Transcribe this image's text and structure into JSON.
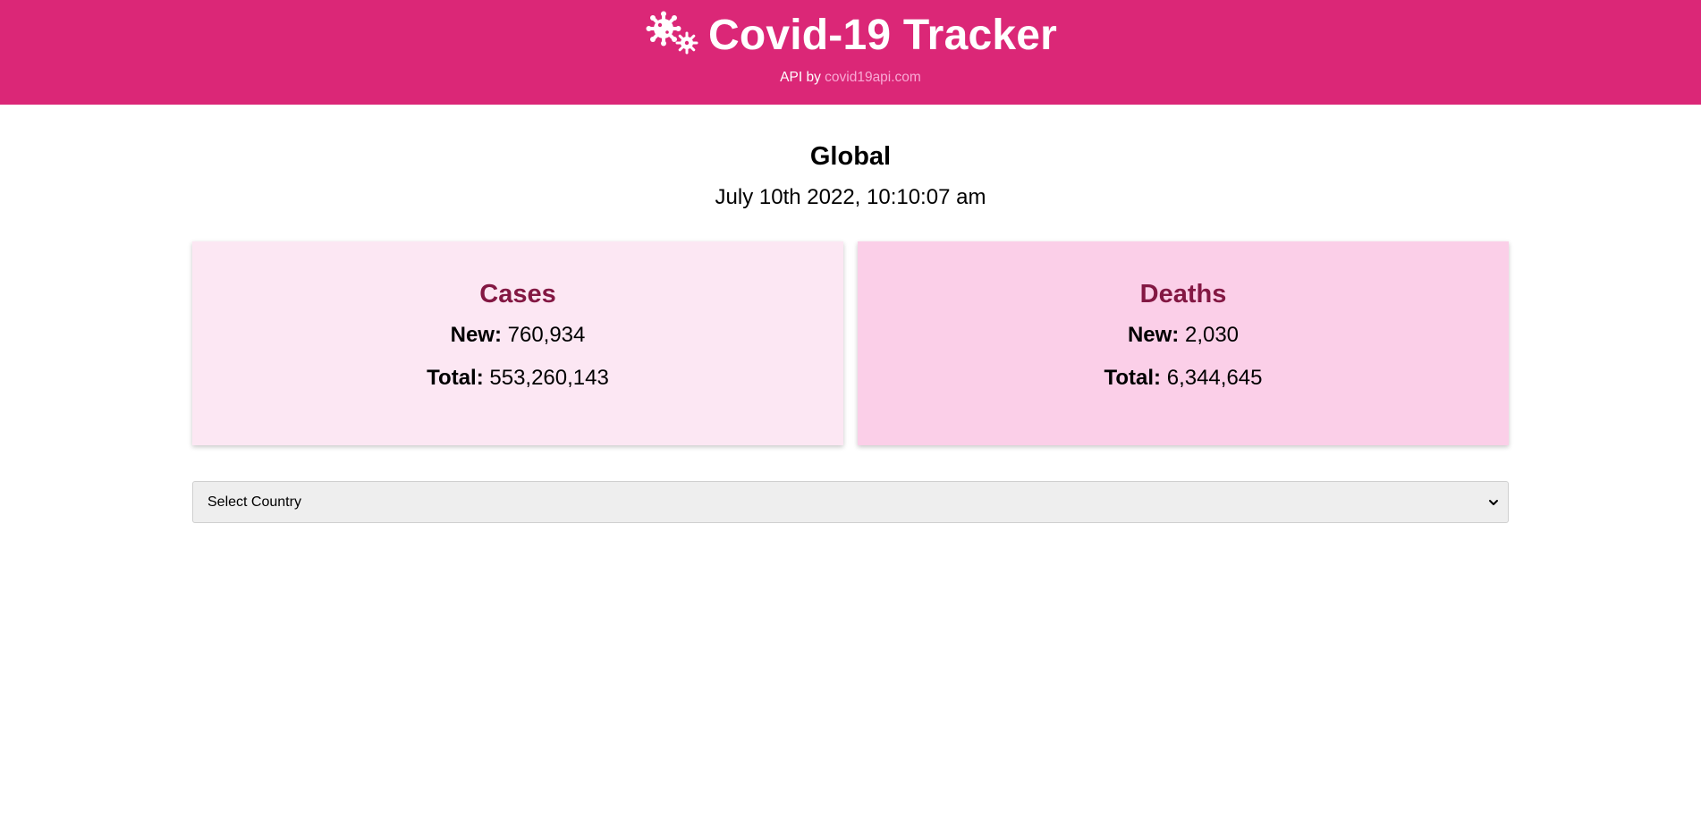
{
  "header": {
    "app_title": "Covid-19 Tracker",
    "api_prefix": "API by",
    "api_link_text": "covid19api.com",
    "logo_icon": "virus-gears-icon",
    "background_color": "#db2777",
    "link_color": "#f9a8d4"
  },
  "main": {
    "region_title": "Global",
    "timestamp": "July 10th 2022, 10:10:07 am",
    "cards": {
      "cases": {
        "title": "Cases",
        "new_label": "New:",
        "new_value": "760,934",
        "total_label": "Total:",
        "total_value": "553,260,143",
        "background_color": "#fce7f3"
      },
      "deaths": {
        "title": "Deaths",
        "new_label": "New:",
        "new_value": "2,030",
        "total_label": "Total:",
        "total_value": "6,344,645",
        "background_color": "#fbcfe8"
      }
    },
    "card_title_color": "#831843",
    "country_select": {
      "selected_value": "Select Country",
      "icon": "chevron-down-icon"
    }
  }
}
